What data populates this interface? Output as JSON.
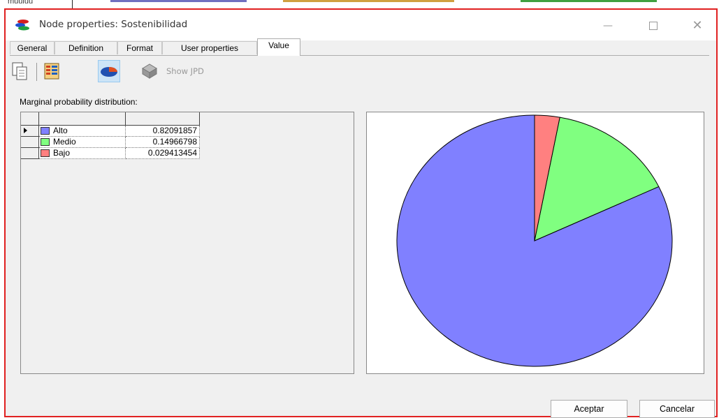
{
  "window": {
    "title": "Node properties: Sostenibilidad",
    "background_text": "muuluu"
  },
  "tabs": [
    {
      "label": "General",
      "active": false
    },
    {
      "label": "Definition",
      "active": false
    },
    {
      "label": "Format",
      "active": false
    },
    {
      "label": "User properties",
      "active": false
    },
    {
      "label": "Value",
      "active": true
    }
  ],
  "toolbar": {
    "copy_icon": "copy-icon",
    "table_icon": "table-view-icon",
    "pie_icon": "pie-chart-icon",
    "jpd_icon": "network-icon",
    "show_jpd_label": "Show JPD"
  },
  "grid": {
    "caption": "Marginal probability distribution:",
    "rows": [
      {
        "state": "Alto",
        "value": "0.82091857",
        "color": "#8080ff"
      },
      {
        "state": "Medio",
        "value": "0.14966798",
        "color": "#80ff80"
      },
      {
        "state": "Bajo",
        "value": "0.029413454",
        "color": "#ff8080"
      }
    ]
  },
  "chart_data": {
    "type": "pie",
    "categories": [
      "Alto",
      "Medio",
      "Bajo"
    ],
    "values": [
      0.82091857,
      0.14966798,
      0.029413454
    ],
    "colors": [
      "#8080ff",
      "#80ff80",
      "#ff8080"
    ],
    "title": "",
    "start_angle_deg": 0,
    "direction": "counterclockwise"
  },
  "footer": {
    "ok_label": "Aceptar",
    "cancel_label": "Cancelar"
  },
  "colors": {
    "accent_border": "#e02020",
    "selected_tool": "#cce4f7"
  }
}
